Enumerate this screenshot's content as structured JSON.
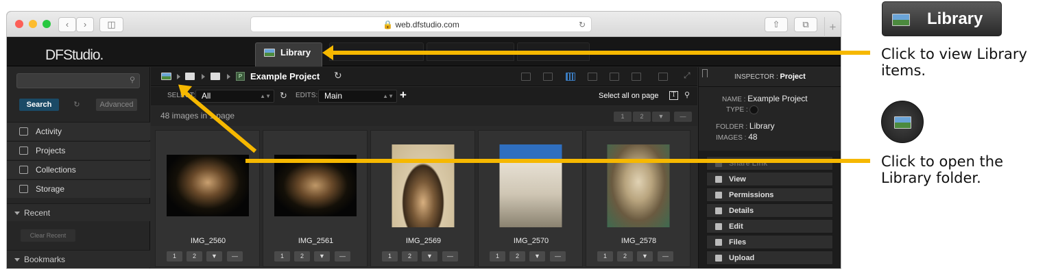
{
  "browser": {
    "url": "web.dfstudio.com"
  },
  "app": {
    "logo": "DFStudio.",
    "active_tab": "Library"
  },
  "sidebar": {
    "search_button": "Search",
    "advanced_button": "Advanced",
    "nav": [
      "Activity",
      "Projects",
      "Collections",
      "Storage"
    ],
    "recent_label": "Recent",
    "clear_recent": "Clear Recent",
    "bookmarks_label": "Bookmarks"
  },
  "main": {
    "project_title": "Example Project",
    "select_label": "SELECT:",
    "select_value": "All",
    "edits_label": "EDITS:",
    "edits_value": "Main",
    "add_symbol": "+",
    "select_all": "Select all on page",
    "count_text": "48 images in 1 page",
    "pages": [
      "1",
      "2"
    ],
    "images": [
      {
        "name": "IMG_2560"
      },
      {
        "name": "IMG_2561"
      },
      {
        "name": "IMG_2569"
      },
      {
        "name": "IMG_2570"
      },
      {
        "name": "IMG_2578"
      }
    ],
    "card_buttons": [
      "1",
      "2"
    ]
  },
  "inspector": {
    "header_label": "INSPECTOR :",
    "header_value": "Project",
    "name_label": "NAME :",
    "name_value": "Example Project",
    "type_label": "TYPE :",
    "folder_label": "FOLDER :",
    "folder_value": "Library",
    "images_label": "IMAGES :",
    "images_value": "48",
    "share_link": "Share Link",
    "actions": [
      "View",
      "Permissions",
      "Details",
      "Edit",
      "Files",
      "Upload"
    ]
  },
  "callouts": {
    "library_button_label": "Library",
    "text1": "Click to view Library items.",
    "text2": "Click to open the Library folder."
  },
  "colors": {
    "arrow": "#f6b800",
    "accent": "#1b4a66"
  }
}
